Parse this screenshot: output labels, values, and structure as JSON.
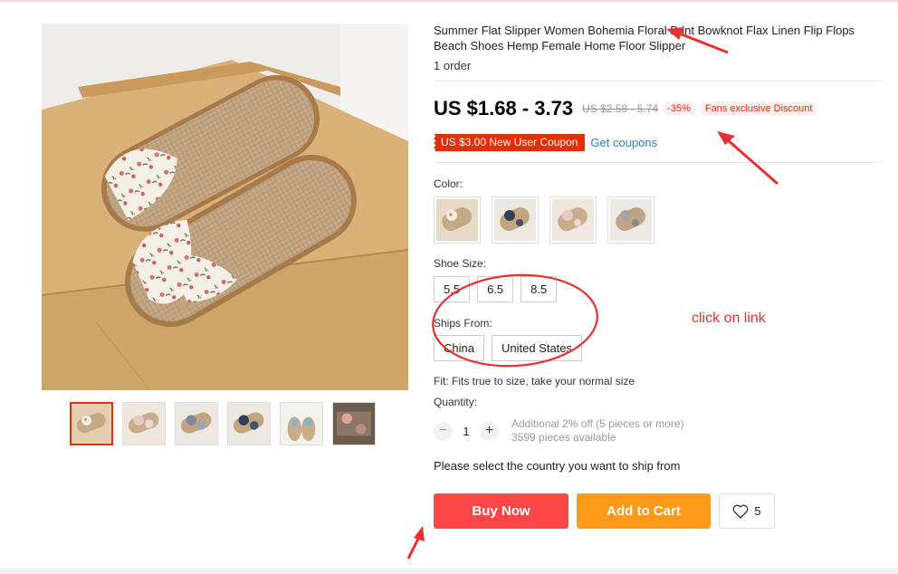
{
  "product": {
    "title": "Summer Flat Slipper Women Bohemia Floral Print Bowknot Flax Linen Flip Flops Beach Shoes Hemp Female Home Floor Slipper",
    "orders": "1 order",
    "price": "US $1.68 - 3.73",
    "old_price": "US $2.58 - 5.74",
    "discount": "-35%",
    "fans_discount": "Fans exclusive Discount",
    "coupon": "US $3.00 New User Coupon",
    "get_coupons": "Get coupons"
  },
  "options": {
    "color_label": "Color:",
    "size_label": "Shoe Size:",
    "sizes": [
      "5.5",
      "6.5",
      "8.5"
    ],
    "ships_label": "Ships From:",
    "ships": [
      "China",
      "United States"
    ],
    "fit": "Fit: Fits true to size, take your normal size"
  },
  "quantity": {
    "label": "Quantity:",
    "value": "1",
    "minus": "−",
    "plus": "+",
    "info_line1": "Additional 2% off (5 pieces or more)",
    "info_line2": "3599 pieces available"
  },
  "ship_message": "Please select the country you want to ship from",
  "actions": {
    "buy_now": "Buy Now",
    "add_to_cart": "Add to Cart",
    "wishlist_count": "5"
  },
  "annotation": {
    "note": "click on link"
  },
  "colors": {
    "accent_red": "#ff4747",
    "accent_orange": "#ff9a1a",
    "link_blue": "#2e7bcf",
    "annotation_red": "#e83030"
  }
}
